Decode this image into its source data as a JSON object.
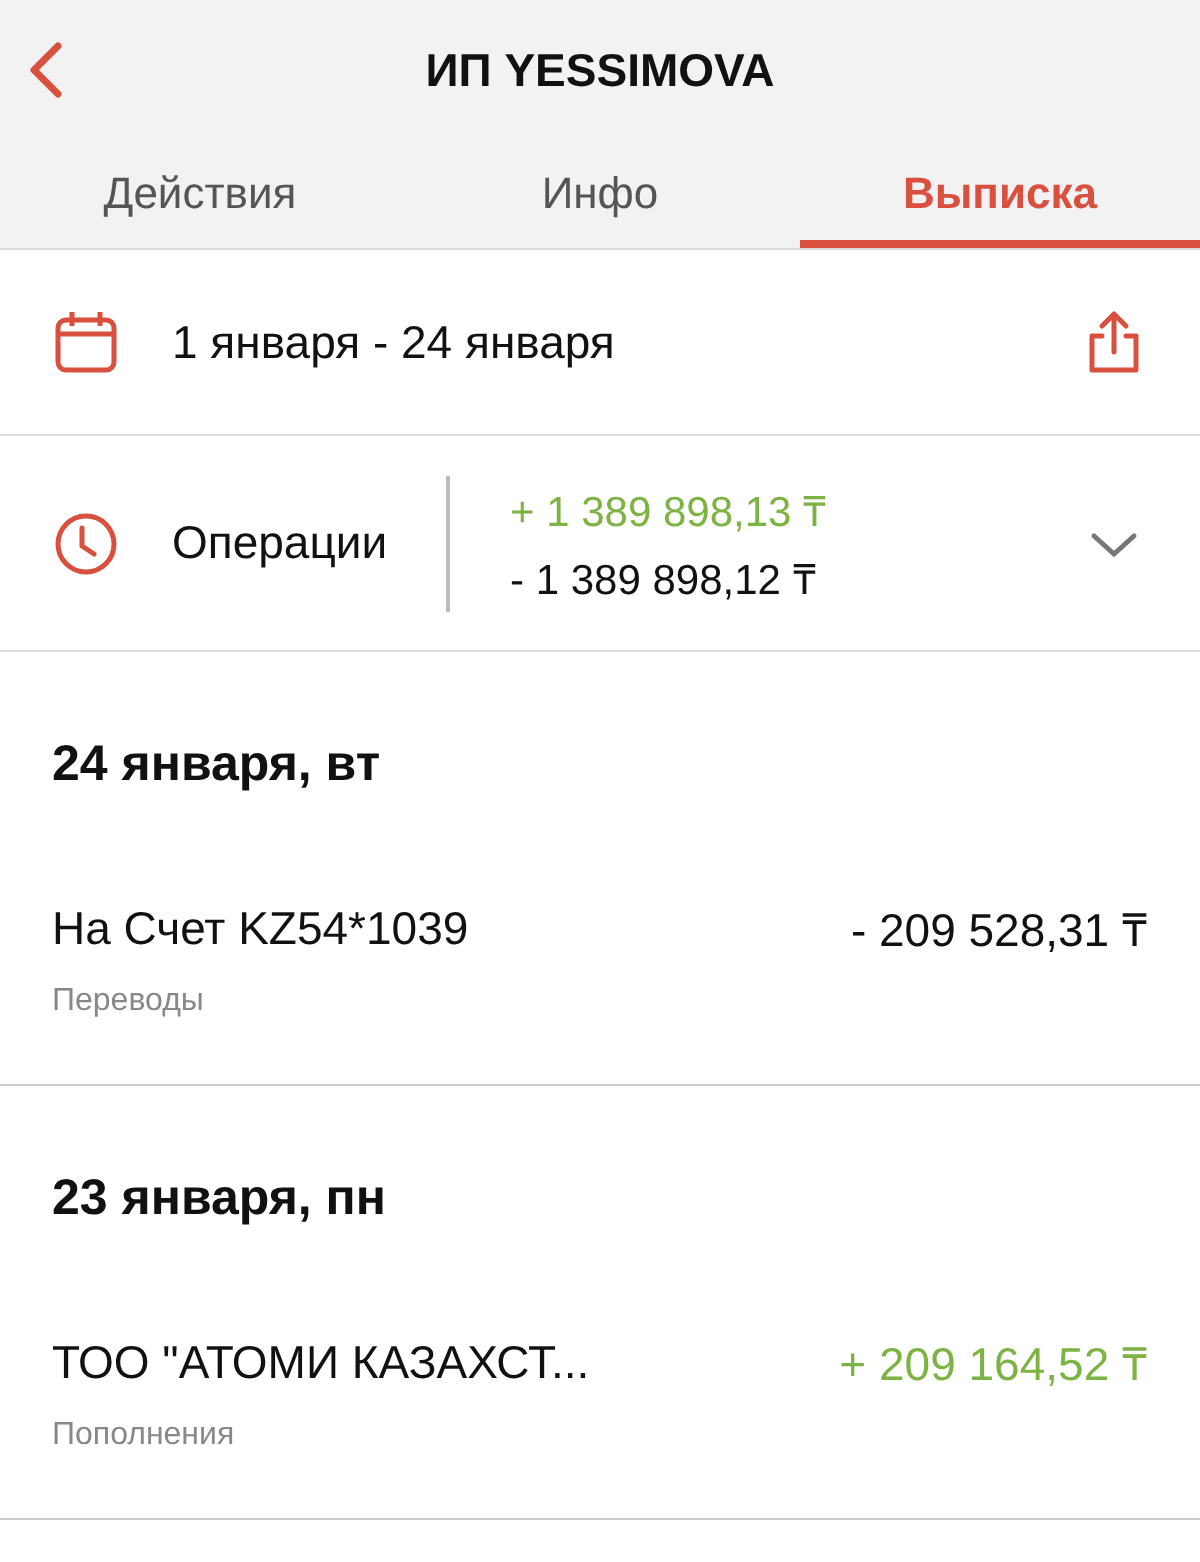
{
  "header": {
    "title": "ИП YESSIMOVA"
  },
  "tabs": [
    {
      "label": "Действия",
      "selected": false
    },
    {
      "label": "Инфо",
      "selected": false
    },
    {
      "label": "Выписка",
      "selected": true
    }
  ],
  "period": {
    "label": "1 января - 24 января"
  },
  "operations": {
    "label": "Операции",
    "totals": [
      {
        "kind": "income",
        "text": "+ 1 389 898,13 ₸"
      },
      {
        "kind": "expense",
        "text": "- 1 389 898,12 ₸"
      }
    ]
  },
  "days": [
    {
      "heading": "24 января, вт",
      "transactions": [
        {
          "title": "На Счет KZ54*1039",
          "category": "Переводы",
          "kind": "expense",
          "amount": "- 209 528,31 ₸"
        }
      ]
    },
    {
      "heading": "23 января, пн",
      "transactions": [
        {
          "title": "ТОО \"АТОМИ КАЗАХСТ...",
          "category": "Пополнения",
          "kind": "income",
          "amount": "+ 209 164,52 ₸"
        }
      ]
    }
  ]
}
